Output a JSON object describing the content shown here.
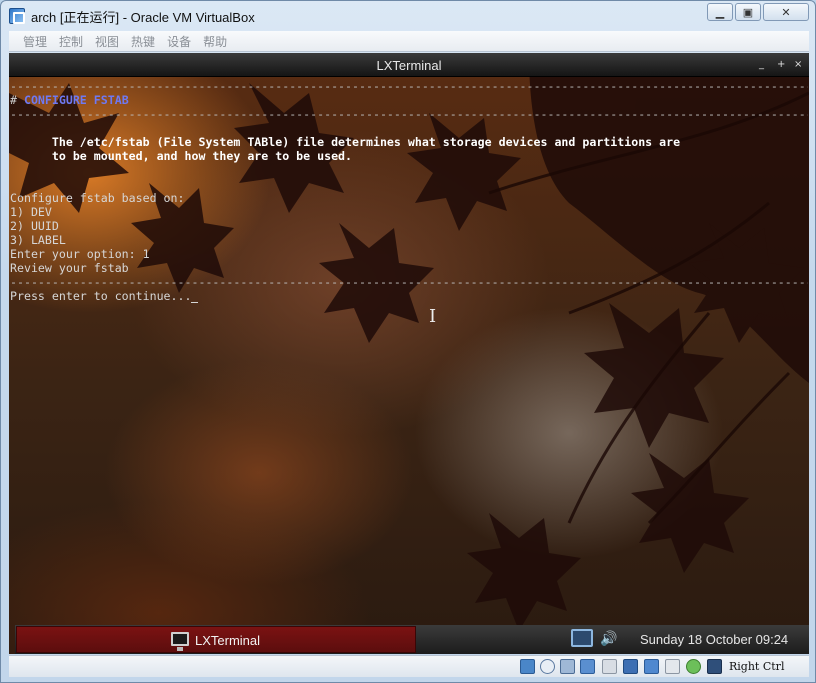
{
  "window": {
    "title": "arch [正在运行] - Oracle VM VirtualBox",
    "minimize_glyph": "▁",
    "maximize_glyph": "▣",
    "close_glyph": "✕"
  },
  "menubar": {
    "items": [
      "管理",
      "控制",
      "视图",
      "热键",
      "设备",
      "帮助"
    ]
  },
  "terminal": {
    "title": "LXTerminal",
    "controls": [
      "_",
      "+",
      "×"
    ],
    "separator": "---------------------------------------------------------------------------------------------------------------------",
    "heading_hash": "# ",
    "heading": "CONFIGURE FSTAB",
    "description_lines": [
      "      The /etc/fstab (File System TABle) file determines what storage devices and partitions are",
      "      to be mounted, and how they are to be used."
    ],
    "body_lines": [
      "Configure fstab based on:",
      "1) DEV",
      "2) UUID",
      "3) LABEL",
      "Enter your option: 1",
      "Review your fstab"
    ],
    "prompt": "Press enter to continue..."
  },
  "panel": {
    "task_label": "LXTerminal",
    "clock": "Sunday 18 October 09:24",
    "volume_glyph": "🔊"
  },
  "statusbar": {
    "host_key": "Right Ctrl",
    "icons": [
      "hard-disk-icon",
      "optical-drive-icon",
      "audio-icon",
      "usb-icon",
      "shared-folder-icon",
      "display-icon",
      "network-icon",
      "video-capture-icon",
      "virtualization-icon",
      "mouse-integration-icon"
    ]
  },
  "colors": {
    "accent_heading": "#6f79f2",
    "panel_task": "#7b1212",
    "vbox_frame": "#c5d8ec"
  }
}
